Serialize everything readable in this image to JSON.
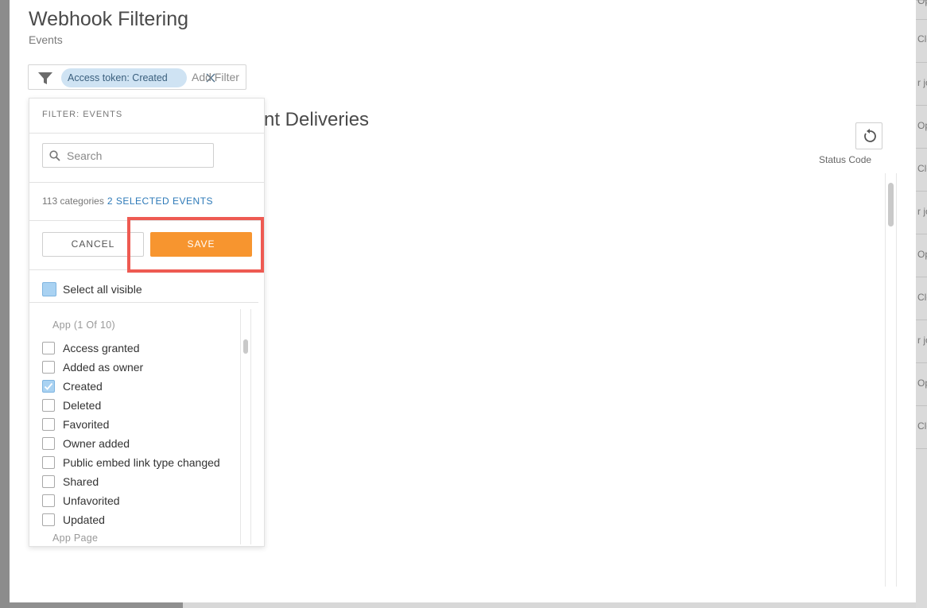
{
  "modal": {
    "title": "Webhook Filtering",
    "subtitle": "Events"
  },
  "filter_bar": {
    "chip_label": "Access token: Created",
    "add_filter_label": "Add Filter"
  },
  "background": {
    "heading_fragment": "nt Deliveries",
    "status_code_label": "Status Code",
    "right_fragments": [
      "Op",
      "Clo",
      "r jo",
      "Op",
      "Clo",
      "r jo",
      "Op",
      "Clo",
      "r jo",
      "Op",
      "Clo"
    ]
  },
  "dropdown": {
    "header": "FILTER: EVENTS",
    "search_placeholder": "Search",
    "category_count": "113 categories",
    "selected_count": "2 SELECTED EVENTS",
    "cancel_label": "CANCEL",
    "save_label": "SAVE",
    "select_all_label": "Select all visible",
    "groups": [
      {
        "label": "App (1 Of 10)",
        "items": [
          {
            "label": "Access granted",
            "checked": false
          },
          {
            "label": "Added as owner",
            "checked": false
          },
          {
            "label": "Created",
            "checked": true
          },
          {
            "label": "Deleted",
            "checked": false
          },
          {
            "label": "Favorited",
            "checked": false
          },
          {
            "label": "Owner added",
            "checked": false
          },
          {
            "label": "Public embed link type changed",
            "checked": false
          },
          {
            "label": "Shared",
            "checked": false
          },
          {
            "label": "Unfavorited",
            "checked": false
          },
          {
            "label": "Updated",
            "checked": false
          }
        ]
      },
      {
        "label": "App Page",
        "items": []
      }
    ]
  },
  "colors": {
    "save_accent": "#f7952f",
    "chip_bg": "#cfe3f3",
    "highlight": "#ee5a52",
    "link": "#2e7ab8"
  }
}
